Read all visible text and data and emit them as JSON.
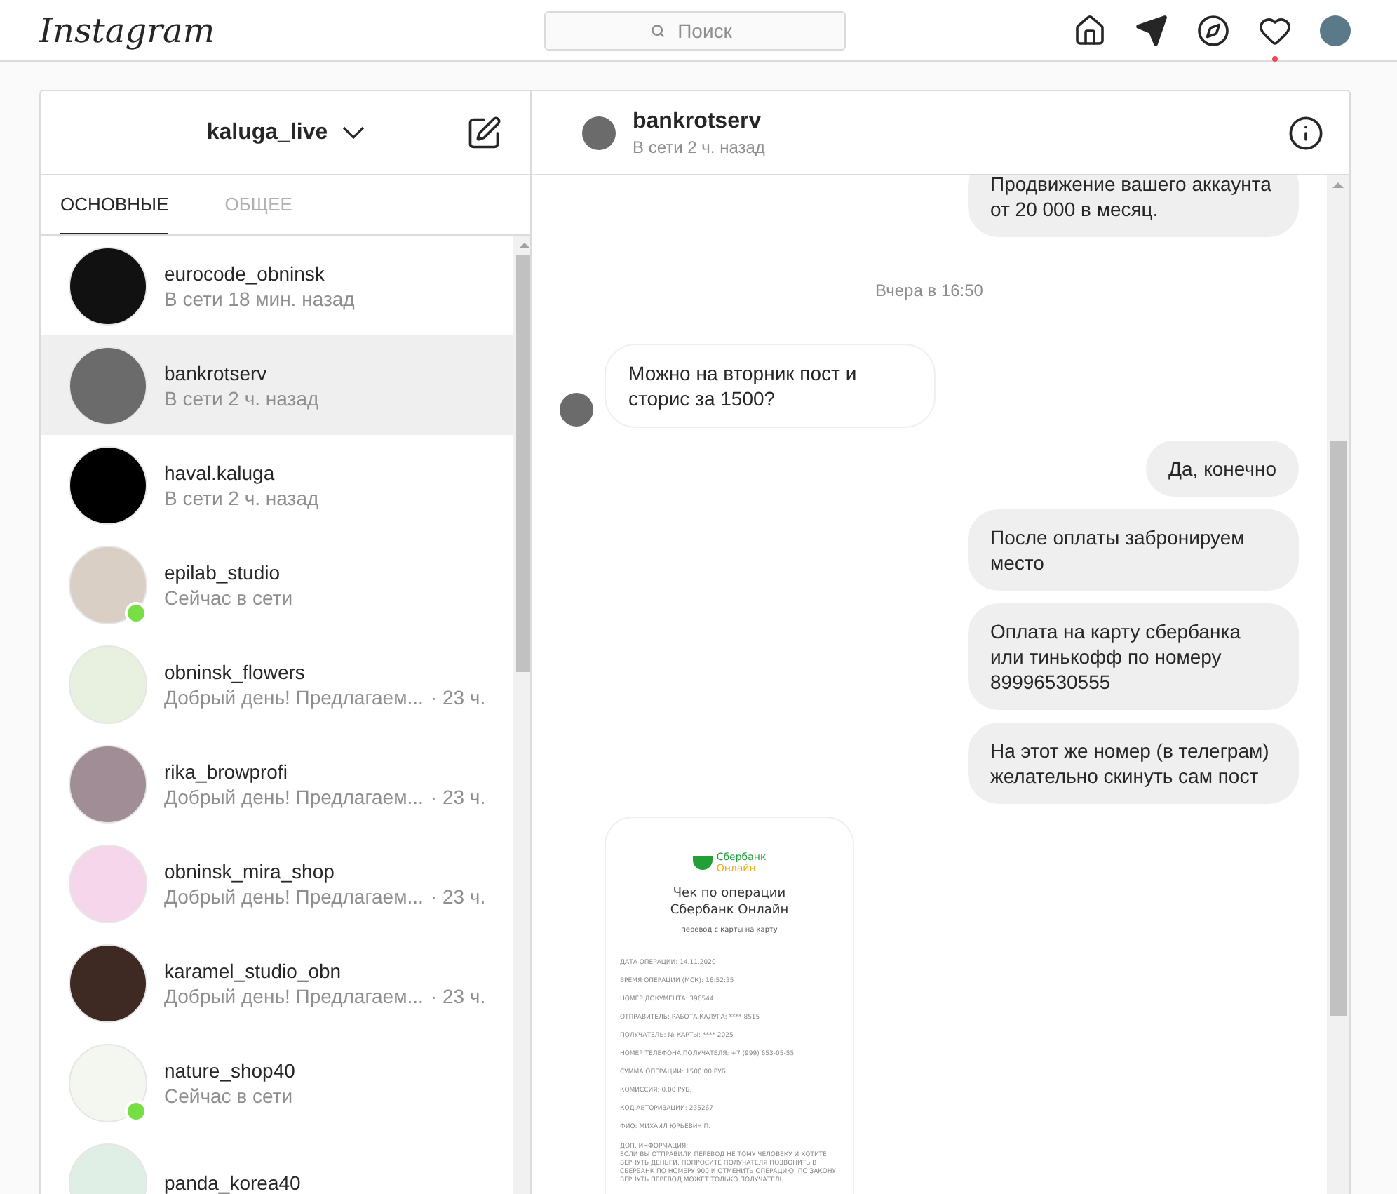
{
  "header": {
    "logo": "Instagram",
    "search": {
      "placeholder": "Поиск"
    },
    "nav": [
      {
        "kind": "home",
        "notification": false
      },
      {
        "kind": "direct",
        "notification": false
      },
      {
        "kind": "explore",
        "notification": false
      },
      {
        "kind": "activity",
        "notification": true
      },
      {
        "kind": "profile",
        "notification": false
      }
    ]
  },
  "sidebar": {
    "account": "kaluga_live",
    "tabs": [
      {
        "label": "ОСНОВНЫЕ",
        "selected": true
      },
      {
        "label": "ОБЩЕЕ",
        "selected": false
      }
    ],
    "conversations": [
      {
        "name": "eurocode_obninsk",
        "status": "В сети 18 мин. назад",
        "online": false,
        "selected": false
      },
      {
        "name": "bankrotserv",
        "status": "В сети 2 ч. назад",
        "online": false,
        "selected": true
      },
      {
        "name": "haval.kaluga",
        "status": "В сети 2 ч. назад",
        "online": false,
        "selected": false
      },
      {
        "name": "epilab_studio",
        "status": "Сейчас в сети",
        "online": true,
        "selected": false
      },
      {
        "name": "obninsk_flowers",
        "status": "Добрый день! Предлагаем...",
        "time": "· 23 ч.",
        "online": false,
        "selected": false
      },
      {
        "name": "rika_browprofi",
        "status": "Добрый день! Предлагаем...",
        "time": "· 23 ч.",
        "online": false,
        "selected": false
      },
      {
        "name": "obninsk_mira_shop",
        "status": "Добрый день! Предлагаем...",
        "time": "· 23 ч.",
        "online": false,
        "selected": false
      },
      {
        "name": "karamel_studio_obn",
        "status": "Добрый день! Предлагаем...",
        "time": "· 23 ч.",
        "online": false,
        "selected": false
      },
      {
        "name": "nature_shop40",
        "status": "Сейчас в сети",
        "online": true,
        "selected": false
      },
      {
        "name": "panda_korea40",
        "online": false,
        "selected": false
      }
    ]
  },
  "chat": {
    "user": "bankrotserv",
    "status": "В сети 2 ч. назад",
    "messages": [
      {
        "kind": "outgoing_text",
        "text": "Продвижение вашего аккаунта от 20 000 в месяц."
      },
      {
        "kind": "time",
        "text": "Вчера в 16:50"
      },
      {
        "kind": "incoming_text",
        "avatar": true,
        "text": "Можно на вторник пост и сторис за 1500?"
      },
      {
        "kind": "outgoing_text",
        "text": "Да, конечно"
      },
      {
        "kind": "outgoing_text",
        "text": "После оплаты забронируем место"
      },
      {
        "kind": "outgoing_text",
        "text": "Оплата на карту сбербанка или тинькофф по номеру 89996530555"
      },
      {
        "kind": "outgoing_text",
        "text": "На этот же номер (в телеграм) желательно скинуть сам пост"
      },
      {
        "kind": "incoming_receipt",
        "avatar": false,
        "receipt": {
          "brand": [
            "Сбербанк",
            "Онлайн"
          ],
          "title": [
            "Чек по операции",
            "Сбербанк Онлайн"
          ],
          "subtitle": "перевод с карты на карту",
          "fields": [
            "ДАТА ОПЕРАЦИИ: 14.11.2020",
            "ВРЕМЯ ОПЕРАЦИИ (МСК): 16:52:35",
            "НОМЕР ДОКУМЕНТА: 396544",
            "ОТПРАВИТЕЛЬ: РАБОТА КАЛУГА: **** 8515",
            "ПОЛУЧАТЕЛЬ: № КАРТЫ: **** 2025",
            "НОМЕР ТЕЛЕФОНА ПОЛУЧАТЕЛЯ: +7 (999) 653-05-55",
            "СУММА ОПЕРАЦИИ: 1500.00 РУБ.",
            "КОМИССИЯ: 0.00 РУБ.",
            "КОД АВТОРИЗАЦИИ: 235267",
            "ФИО: МИХАИЛ ЮРЬЕВИЧ П."
          ],
          "note_title": "ДОП. ИНФОРМАЦИЯ:",
          "note": "ЕСЛИ ВЫ ОТПРАВИЛИ ПЕРЕВОД НЕ ТОМУ ЧЕЛОВЕКУ И ХОТИТЕ ВЕРНУТЬ ДЕНЬГИ, ПОПРОСИТЕ ПОЛУЧАТЕЛЯ ПОЗВОНИТЬ В СБЕРБАНК ПО НОМЕРУ 900 И ОТМЕНИТЬ ОПЕРАЦИЮ. ПО ЗАКОНУ ВЕРНУТЬ ПЕРЕВОД МОЖЕТ ТОЛЬКО ПОЛУЧАТЕЛЬ."
        }
      }
    ]
  }
}
